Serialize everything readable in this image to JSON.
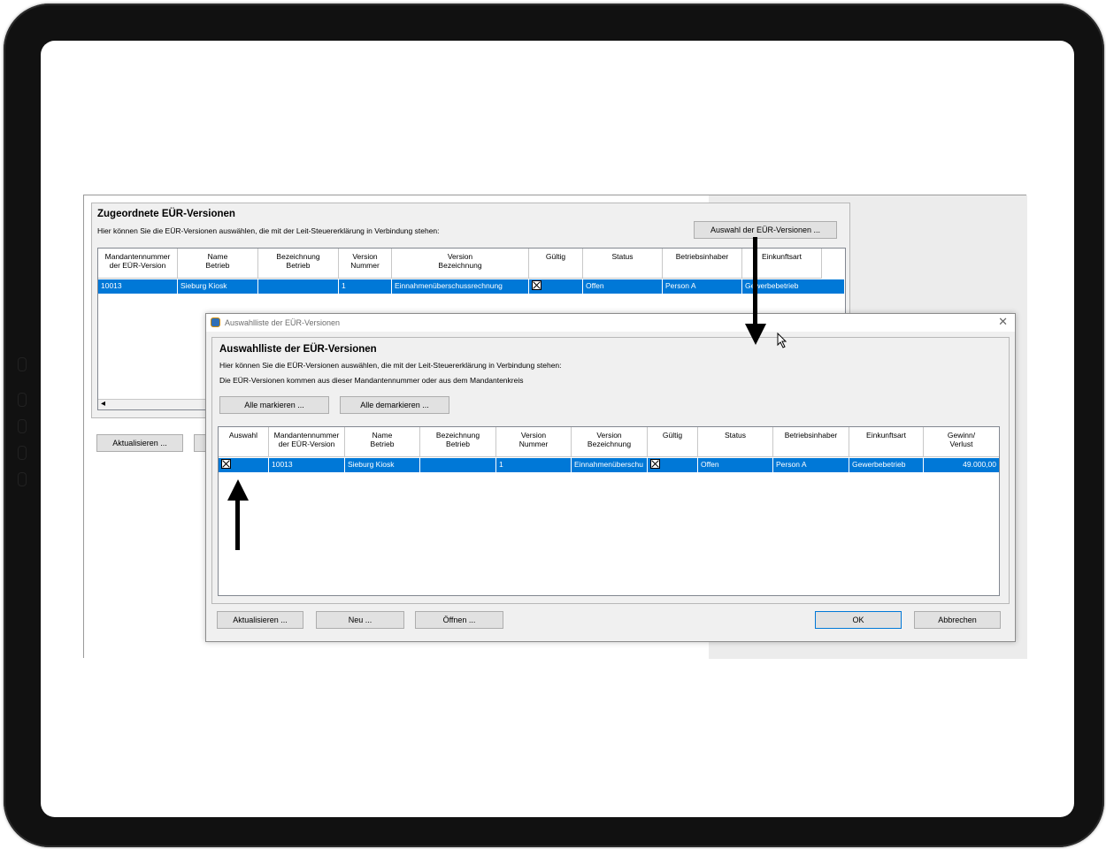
{
  "main_window": {
    "group_title": "Zugeordnete EÜR-Versionen",
    "group_description": "Hier können Sie die EÜR-Versionen auswählen, die mit der Leit-Steuererklärung in Verbindung stehen:",
    "select_button": "Auswahl der EÜR-Versionen ...",
    "columns": [
      "Mandantennummer\nder EÜR-Version",
      "Name\nBetrieb",
      "Bezeichnung\nBetrieb",
      "Version\nNummer",
      "Version\nBezeichnung",
      "Gültig",
      "Status",
      "Betriebsinhaber",
      "Einkunftsart"
    ],
    "row": {
      "mandant": "10013",
      "name": "Sieburg Kiosk",
      "bezeichnung": "",
      "version_nummer": "1",
      "version_bezeichnung": "Einnahmenüberschussrechnung",
      "gueltig": true,
      "status": "Offen",
      "inhaber": "Person A",
      "einkunftsart": "Gewerbebetrieb"
    },
    "scroll_left_glyph": "◂",
    "refresh_button": "Aktualisieren ..."
  },
  "dialog": {
    "title": "Auswahlliste der EÜR-Versionen",
    "heading": "Auswahlliste der EÜR-Versionen",
    "line1": "Hier können Sie die EÜR-Versionen auswählen, die mit der Leit-Steuererklärung in Verbindung stehen:",
    "line2": "Die EÜR-Versionen kommen aus dieser Mandantennummer oder aus dem Mandantenkreis",
    "mark_all": "Alle markieren ...",
    "unmark_all": "Alle demarkieren ...",
    "columns": [
      "Auswahl",
      "Mandantennummer\nder EÜR-Version",
      "Name\nBetrieb",
      "Bezeichnung\nBetrieb",
      "Version\nNummer",
      "Version\nBezeichnung",
      "Gültig",
      "Status",
      "Betriebsinhaber",
      "Einkunftsart",
      "Gewinn/\nVerlust"
    ],
    "row": {
      "auswahl": true,
      "mandant": "10013",
      "name": "Sieburg Kiosk",
      "bezeichnung": "",
      "version_nummer": "1",
      "version_bezeichnung": "Einnahmenüberschu",
      "gueltig": true,
      "status": "Offen",
      "inhaber": "Person A",
      "einkunftsart": "Gewerbebetrieb",
      "gewinn": "49.000,00"
    },
    "buttons": {
      "refresh": "Aktualisieren ...",
      "new": "Neu ...",
      "open": "Öffnen ...",
      "ok": "OK",
      "cancel": "Abbrechen"
    },
    "close_glyph": "✕"
  },
  "colors": {
    "selection": "#0078d7",
    "annotation_arrow": "#000000"
  }
}
